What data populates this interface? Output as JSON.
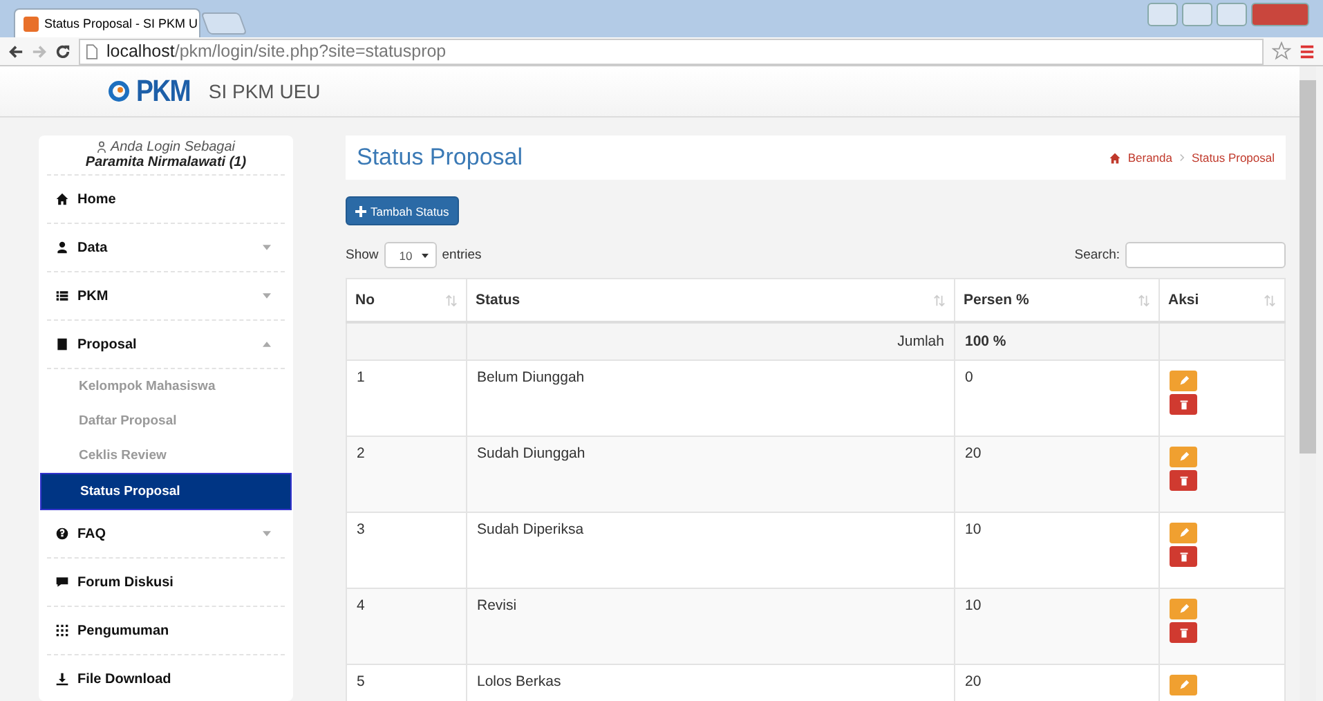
{
  "browser": {
    "tab_title": "Status Proposal - SI PKM U",
    "url_host": "localhost",
    "url_path": "/pkm/login/site.php?site=statusprop"
  },
  "navbar": {
    "logo_text": "PKM",
    "brand": "SI PKM UEU"
  },
  "sidebar": {
    "login_label": "Anda Login Sebagai",
    "user": "Paramita Nirmalawati (1)",
    "items": [
      {
        "label": "Home",
        "kind": "link"
      },
      {
        "label": "Data",
        "kind": "menu",
        "expanded": false
      },
      {
        "label": "PKM",
        "kind": "menu",
        "expanded": false
      },
      {
        "label": "Proposal",
        "kind": "menu",
        "expanded": true,
        "children": [
          {
            "label": "Kelompok Mahasiswa",
            "selected": false
          },
          {
            "label": "Daftar Proposal",
            "selected": false
          },
          {
            "label": "Ceklis Review",
            "selected": false
          },
          {
            "label": "Status Proposal",
            "selected": true
          }
        ]
      },
      {
        "label": "FAQ",
        "kind": "menu",
        "expanded": false
      },
      {
        "label": "Forum Diskusi",
        "kind": "link"
      },
      {
        "label": "Pengumuman",
        "kind": "link"
      },
      {
        "label": "File Download",
        "kind": "link"
      }
    ]
  },
  "page": {
    "title": "Status Proposal",
    "breadcrumb": [
      "Beranda",
      "Status Proposal"
    ],
    "add_button": "Tambah Status"
  },
  "table_controls": {
    "show_label": "Show",
    "page_size": "10",
    "entries_label": "entries",
    "search_label": "Search:"
  },
  "table": {
    "columns": [
      "No",
      "Status",
      "Persen %",
      "Aksi"
    ],
    "total": {
      "label": "Jumlah",
      "value": "100 %"
    },
    "rows": [
      {
        "no": "1",
        "status": "Belum Diunggah",
        "persen": "0",
        "actions": [
          {
            "kind": "edit"
          },
          {
            "kind": "delete"
          }
        ]
      },
      {
        "no": "2",
        "status": "Sudah Diunggah",
        "persen": "20",
        "actions": [
          {
            "kind": "edit"
          },
          {
            "kind": "delete"
          }
        ]
      },
      {
        "no": "3",
        "status": "Sudah Diperiksa",
        "persen": "10",
        "actions": [
          {
            "kind": "edit"
          },
          {
            "kind": "delete"
          }
        ]
      },
      {
        "no": "4",
        "status": "Revisi",
        "persen": "10",
        "actions": [
          {
            "kind": "edit"
          },
          {
            "kind": "delete"
          }
        ]
      },
      {
        "no": "5",
        "status": "Lolos Berkas",
        "persen": "20",
        "actions": [
          {
            "kind": "edit"
          }
        ]
      }
    ]
  }
}
